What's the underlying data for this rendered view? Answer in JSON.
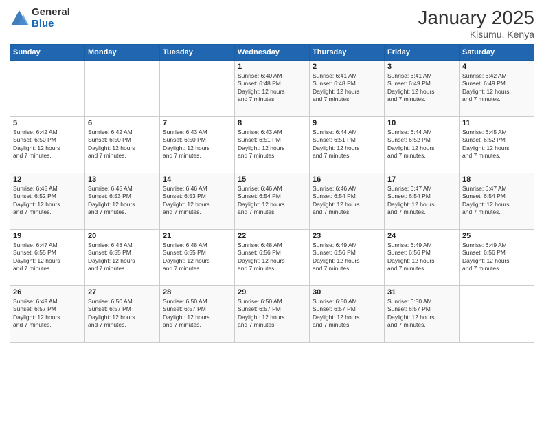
{
  "logo": {
    "general": "General",
    "blue": "Blue"
  },
  "title": "January 2025",
  "subtitle": "Kisumu, Kenya",
  "days_header": [
    "Sunday",
    "Monday",
    "Tuesday",
    "Wednesday",
    "Thursday",
    "Friday",
    "Saturday"
  ],
  "weeks": [
    [
      {
        "num": "",
        "info": ""
      },
      {
        "num": "",
        "info": ""
      },
      {
        "num": "",
        "info": ""
      },
      {
        "num": "1",
        "info": "Sunrise: 6:40 AM\nSunset: 6:48 PM\nDaylight: 12 hours\nand 7 minutes."
      },
      {
        "num": "2",
        "info": "Sunrise: 6:41 AM\nSunset: 6:48 PM\nDaylight: 12 hours\nand 7 minutes."
      },
      {
        "num": "3",
        "info": "Sunrise: 6:41 AM\nSunset: 6:49 PM\nDaylight: 12 hours\nand 7 minutes."
      },
      {
        "num": "4",
        "info": "Sunrise: 6:42 AM\nSunset: 6:49 PM\nDaylight: 12 hours\nand 7 minutes."
      }
    ],
    [
      {
        "num": "5",
        "info": "Sunrise: 6:42 AM\nSunset: 6:50 PM\nDaylight: 12 hours\nand 7 minutes."
      },
      {
        "num": "6",
        "info": "Sunrise: 6:42 AM\nSunset: 6:50 PM\nDaylight: 12 hours\nand 7 minutes."
      },
      {
        "num": "7",
        "info": "Sunrise: 6:43 AM\nSunset: 6:50 PM\nDaylight: 12 hours\nand 7 minutes."
      },
      {
        "num": "8",
        "info": "Sunrise: 6:43 AM\nSunset: 6:51 PM\nDaylight: 12 hours\nand 7 minutes."
      },
      {
        "num": "9",
        "info": "Sunrise: 6:44 AM\nSunset: 6:51 PM\nDaylight: 12 hours\nand 7 minutes."
      },
      {
        "num": "10",
        "info": "Sunrise: 6:44 AM\nSunset: 6:52 PM\nDaylight: 12 hours\nand 7 minutes."
      },
      {
        "num": "11",
        "info": "Sunrise: 6:45 AM\nSunset: 6:52 PM\nDaylight: 12 hours\nand 7 minutes."
      }
    ],
    [
      {
        "num": "12",
        "info": "Sunrise: 6:45 AM\nSunset: 6:52 PM\nDaylight: 12 hours\nand 7 minutes."
      },
      {
        "num": "13",
        "info": "Sunrise: 6:45 AM\nSunset: 6:53 PM\nDaylight: 12 hours\nand 7 minutes."
      },
      {
        "num": "14",
        "info": "Sunrise: 6:46 AM\nSunset: 6:53 PM\nDaylight: 12 hours\nand 7 minutes."
      },
      {
        "num": "15",
        "info": "Sunrise: 6:46 AM\nSunset: 6:54 PM\nDaylight: 12 hours\nand 7 minutes."
      },
      {
        "num": "16",
        "info": "Sunrise: 6:46 AM\nSunset: 6:54 PM\nDaylight: 12 hours\nand 7 minutes."
      },
      {
        "num": "17",
        "info": "Sunrise: 6:47 AM\nSunset: 6:54 PM\nDaylight: 12 hours\nand 7 minutes."
      },
      {
        "num": "18",
        "info": "Sunrise: 6:47 AM\nSunset: 6:54 PM\nDaylight: 12 hours\nand 7 minutes."
      }
    ],
    [
      {
        "num": "19",
        "info": "Sunrise: 6:47 AM\nSunset: 6:55 PM\nDaylight: 12 hours\nand 7 minutes."
      },
      {
        "num": "20",
        "info": "Sunrise: 6:48 AM\nSunset: 6:55 PM\nDaylight: 12 hours\nand 7 minutes."
      },
      {
        "num": "21",
        "info": "Sunrise: 6:48 AM\nSunset: 6:55 PM\nDaylight: 12 hours\nand 7 minutes."
      },
      {
        "num": "22",
        "info": "Sunrise: 6:48 AM\nSunset: 6:56 PM\nDaylight: 12 hours\nand 7 minutes."
      },
      {
        "num": "23",
        "info": "Sunrise: 6:49 AM\nSunset: 6:56 PM\nDaylight: 12 hours\nand 7 minutes."
      },
      {
        "num": "24",
        "info": "Sunrise: 6:49 AM\nSunset: 6:56 PM\nDaylight: 12 hours\nand 7 minutes."
      },
      {
        "num": "25",
        "info": "Sunrise: 6:49 AM\nSunset: 6:56 PM\nDaylight: 12 hours\nand 7 minutes."
      }
    ],
    [
      {
        "num": "26",
        "info": "Sunrise: 6:49 AM\nSunset: 6:57 PM\nDaylight: 12 hours\nand 7 minutes."
      },
      {
        "num": "27",
        "info": "Sunrise: 6:50 AM\nSunset: 6:57 PM\nDaylight: 12 hours\nand 7 minutes."
      },
      {
        "num": "28",
        "info": "Sunrise: 6:50 AM\nSunset: 6:57 PM\nDaylight: 12 hours\nand 7 minutes."
      },
      {
        "num": "29",
        "info": "Sunrise: 6:50 AM\nSunset: 6:57 PM\nDaylight: 12 hours\nand 7 minutes."
      },
      {
        "num": "30",
        "info": "Sunrise: 6:50 AM\nSunset: 6:57 PM\nDaylight: 12 hours\nand 7 minutes."
      },
      {
        "num": "31",
        "info": "Sunrise: 6:50 AM\nSunset: 6:57 PM\nDaylight: 12 hours\nand 7 minutes."
      },
      {
        "num": "",
        "info": ""
      }
    ]
  ]
}
